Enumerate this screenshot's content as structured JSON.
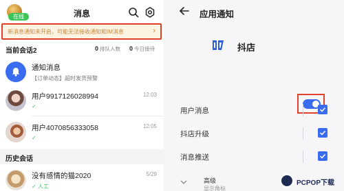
{
  "left": {
    "title": "消息",
    "online_badge": "在线",
    "banner": {
      "text": "新消息通知未开启，可能无法接收通知和IM消息",
      "arrow": "›"
    },
    "current": {
      "title": "当前会话2",
      "queue_count": "0",
      "queue_label": "排队人数",
      "today_count": "0",
      "today_label": "今日接待"
    },
    "rows": [
      {
        "name": "通知消息",
        "sub": "【订单动态】超时发货预警",
        "time": ""
      },
      {
        "name": "用户9917126028994",
        "sub": "✓",
        "time": "12:03"
      },
      {
        "name": "用户4070856333058",
        "sub": "✓",
        "time": "12:05"
      }
    ],
    "history": {
      "title": "历史会话",
      "rows": [
        {
          "name": "没有感情的猫2020",
          "sub": "✓ 人工",
          "time": "5/29"
        }
      ]
    }
  },
  "right": {
    "title": "应用通知",
    "app_name": "抖店",
    "toggle_on": true,
    "settings": [
      {
        "label": "用户消息",
        "checked": true
      },
      {
        "label": "抖店升级",
        "checked": true
      },
      {
        "label": "消息推送",
        "checked": true
      }
    ],
    "advanced": {
      "label": "高级",
      "sub": "显示角标"
    }
  },
  "watermark": {
    "text": "PCPOP下载"
  },
  "colors": {
    "accent": "#3a6cf0",
    "highlight_border": "#e0402a",
    "banner_text": "#c8893a",
    "online": "#3cc65a"
  }
}
